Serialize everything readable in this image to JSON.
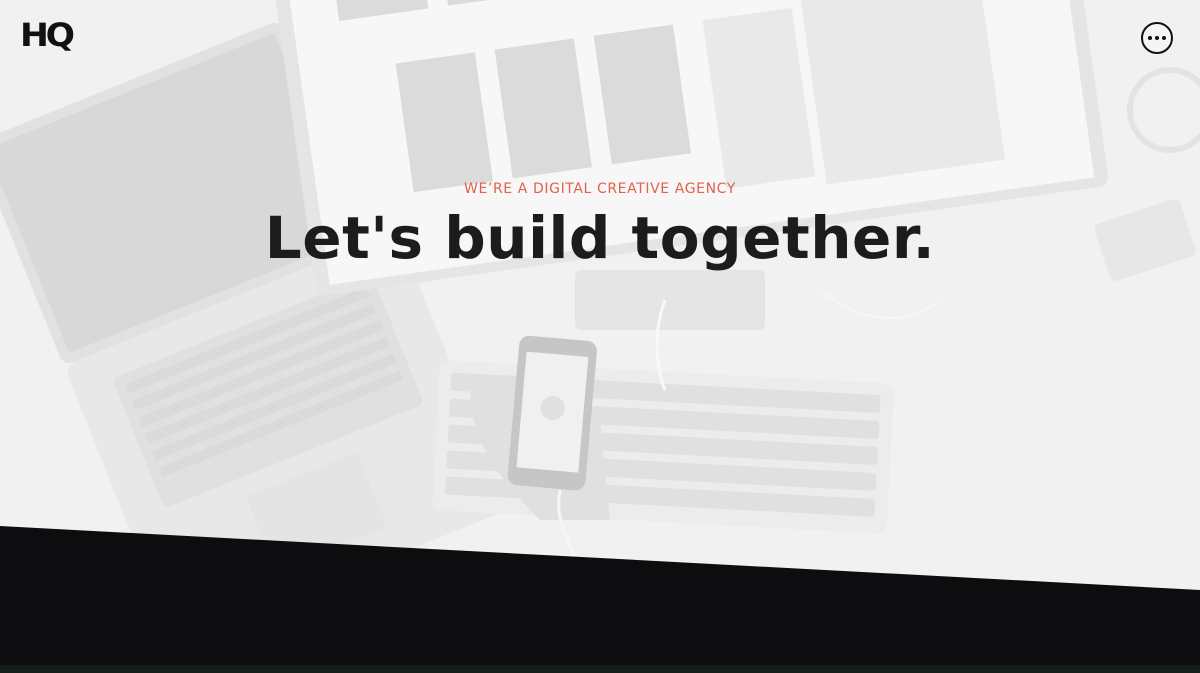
{
  "header": {
    "logo_text": "HQ",
    "menu_icon": "more-horizontal-icon"
  },
  "hero": {
    "tagline": "WE’RE A DIGITAL CREATIVE AGENCY",
    "headline": "Let's build together.",
    "background": "desk with laptop, monitor, keyboard and phone (desaturated photo)"
  },
  "colors": {
    "accent": "#e0634b",
    "text_dark": "#1c1c1c",
    "band_dark": "#0d0d10"
  }
}
